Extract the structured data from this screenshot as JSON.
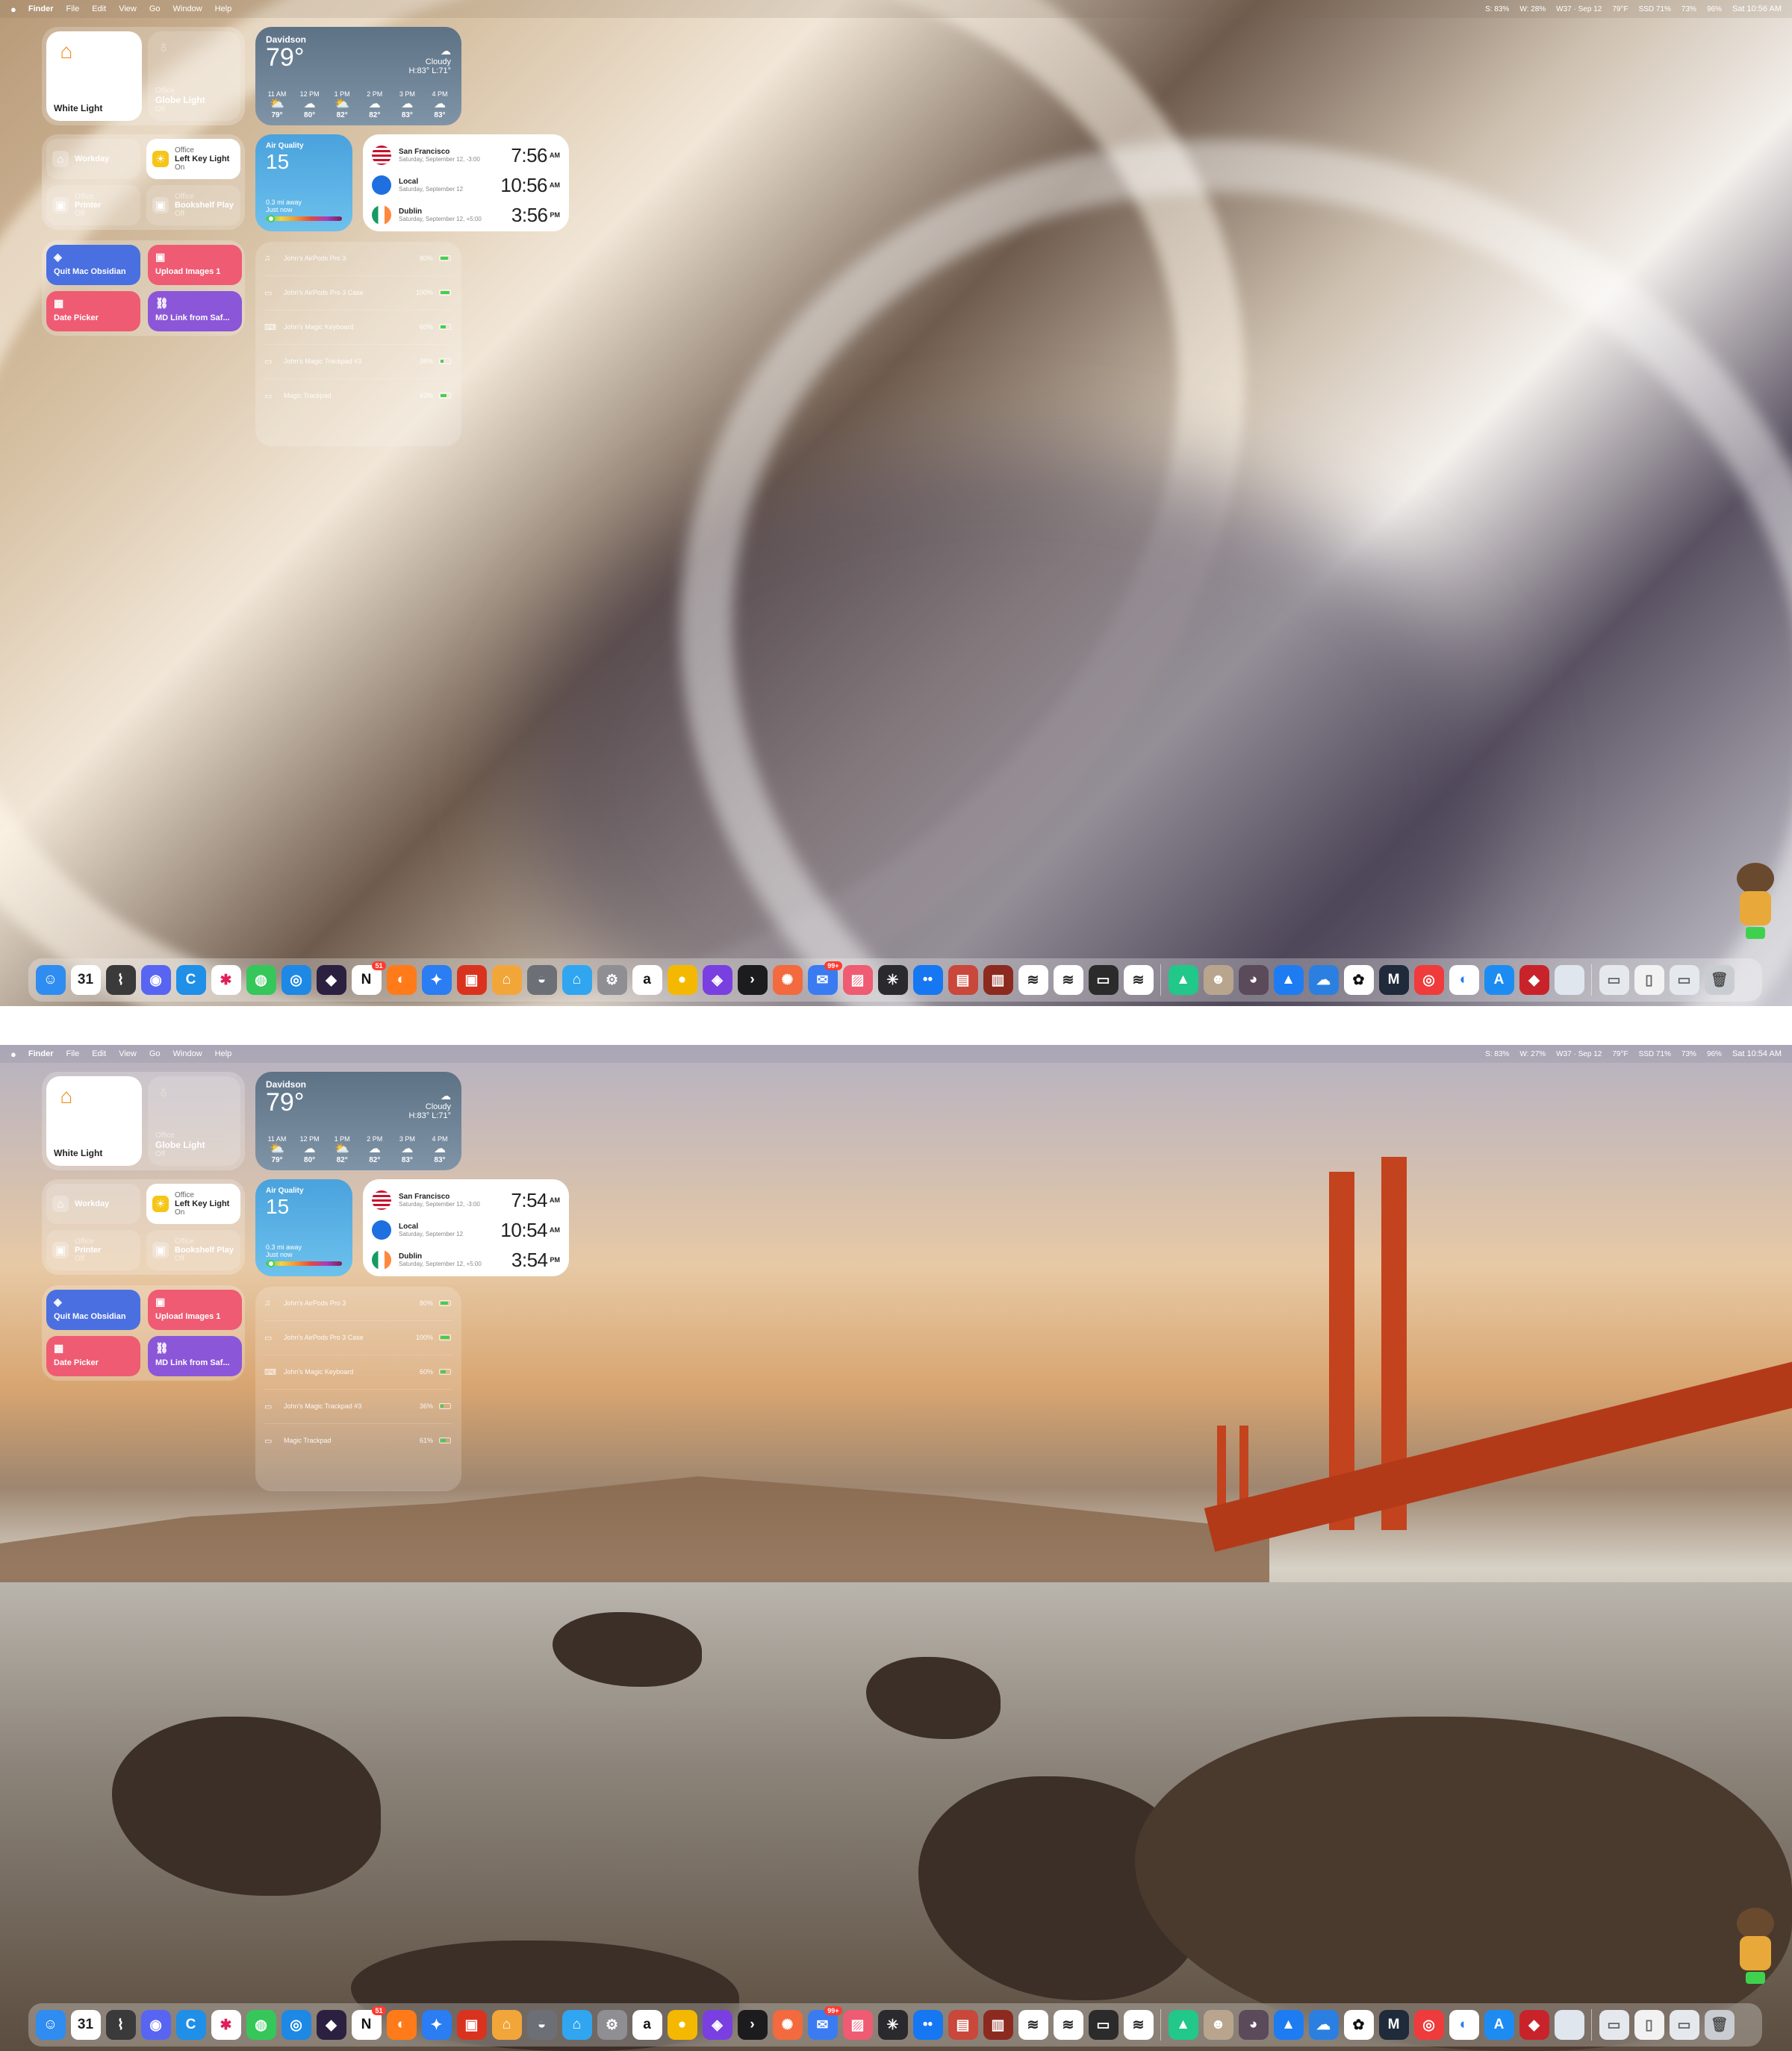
{
  "menubar": {
    "app": "Finder",
    "menus": [
      "File",
      "Edit",
      "View",
      "Go",
      "Window",
      "Help"
    ],
    "status": [
      "S: 83%",
      "79°F",
      "73%",
      "96%"
    ],
    "week": "W37 · Sep 12",
    "mem": "SSD 71%"
  },
  "screens": [
    {
      "w_status": "W: 28%",
      "clock": "Sat 10:56 AM"
    },
    {
      "w_status": "W: 27%",
      "clock": "Sat 10:54 AM"
    }
  ],
  "homekit": {
    "white_light": "White Light",
    "globe": {
      "room": "Office",
      "name": "Globe Light",
      "state": "Off"
    },
    "workday": "Workday",
    "left_key": {
      "room": "Office",
      "name": "Left Key Light",
      "state": "On"
    },
    "printer": {
      "room": "Office",
      "name": "Printer",
      "state": "Off"
    },
    "bookshelf": {
      "room": "Office",
      "name": "Bookshelf Play",
      "state": "Off"
    }
  },
  "weather": {
    "city": "Davidson",
    "temp": "79°",
    "condition": "Cloudy",
    "hilo": "H:83° L:71°",
    "hours": [
      {
        "time": "11 AM",
        "temp": "79°",
        "icon": "⛅"
      },
      {
        "time": "12 PM",
        "temp": "80°",
        "icon": "☁"
      },
      {
        "time": "1 PM",
        "temp": "82°",
        "icon": "⛅"
      },
      {
        "time": "2 PM",
        "temp": "82°",
        "icon": "☁"
      },
      {
        "time": "3 PM",
        "temp": "83°",
        "icon": "☁"
      },
      {
        "time": "4 PM",
        "temp": "83°",
        "icon": "☁"
      }
    ]
  },
  "air_quality": {
    "label": "Air Quality",
    "value": "15",
    "distance": "0.3 mi away",
    "updated": "Just now"
  },
  "world_clock": [
    {
      "city": "San Francisco",
      "date": "Saturday, September 12, -3:00",
      "times": [
        "7:56",
        "7:54"
      ],
      "ampm": "AM",
      "flag": "us"
    },
    {
      "city": "Local",
      "date": "Saturday, September 12",
      "times": [
        "10:56",
        "10:54"
      ],
      "ampm": "AM",
      "flag": "local"
    },
    {
      "city": "Dublin",
      "date": "Saturday, September 12, +5:00",
      "times": [
        "3:56",
        "3:54"
      ],
      "ampm": "PM",
      "flag": "ie"
    }
  ],
  "shortcuts": [
    {
      "label": "Quit Mac Obsidian",
      "color": "#4a6fe0",
      "icon": "layers-icon"
    },
    {
      "label": "Upload Images 1",
      "color": "#ef5b73",
      "icon": "photo-icon"
    },
    {
      "label": "Date Picker",
      "color": "#ef5b73",
      "icon": "calendar-icon"
    },
    {
      "label": "MD Link from Saf...",
      "color": "#8b56d8",
      "icon": "link-icon"
    }
  ],
  "batteries": {
    "screen1": [
      {
        "name": "John's AirPods Pro 3",
        "pct": "80%",
        "level": 0.8,
        "icon": "earbuds-icon"
      },
      {
        "name": "John's AirPods Pro 3 Case",
        "pct": "100%",
        "level": 1.0,
        "icon": "case-icon"
      },
      {
        "name": "John's Magic Keyboard",
        "pct": "60%",
        "level": 0.6,
        "icon": "keyboard-icon"
      },
      {
        "name": "John's Magic Trackpad #3",
        "pct": "36%",
        "level": 0.36,
        "icon": "trackpad-icon"
      },
      {
        "name": "Magic Trackpad",
        "pct": "63%",
        "level": 0.63,
        "icon": "trackpad-icon"
      }
    ],
    "screen2": [
      {
        "name": "John's AirPods Pro 3",
        "pct": "80%",
        "level": 0.8,
        "icon": "earbuds-icon"
      },
      {
        "name": "John's AirPods Pro 3 Case",
        "pct": "100%",
        "level": 1.0,
        "icon": "case-icon"
      },
      {
        "name": "John's Magic Keyboard",
        "pct": "60%",
        "level": 0.6,
        "icon": "keyboard-icon"
      },
      {
        "name": "John's Magic Trackpad #3",
        "pct": "36%",
        "level": 0.36,
        "icon": "trackpad-icon"
      },
      {
        "name": "Magic Trackpad",
        "pct": "61%",
        "level": 0.61,
        "icon": "trackpad-icon"
      }
    ]
  },
  "dock": {
    "apps": [
      {
        "name": "finder-icon",
        "color": "#2f8cf0",
        "glyph": "☺"
      },
      {
        "name": "calendar-icon",
        "color": "#ffffff",
        "glyph": "31",
        "text": "#222"
      },
      {
        "name": "rss-icon",
        "color": "#3a3a3a",
        "glyph": "⌇"
      },
      {
        "name": "discord-icon",
        "color": "#5865f2",
        "glyph": "◉"
      },
      {
        "name": "c-icon",
        "color": "#1f8fe8",
        "glyph": "C"
      },
      {
        "name": "slack-icon",
        "color": "#ffffff",
        "glyph": "✱",
        "text": "#e01e5a"
      },
      {
        "name": "messages-icon",
        "color": "#35c759",
        "glyph": "◍"
      },
      {
        "name": "safari-icon",
        "color": "#1e88e5",
        "glyph": "◎"
      },
      {
        "name": "obsidian-icon",
        "color": "#2b2040",
        "glyph": "◆"
      },
      {
        "name": "notion-icon",
        "color": "#ffffff",
        "glyph": "N",
        "text": "#111",
        "badge": "51"
      },
      {
        "name": "firefox-icon",
        "color": "#ff7b1a",
        "glyph": "◐"
      },
      {
        "name": "app-icon",
        "color": "#2a7df2",
        "glyph": "✦"
      },
      {
        "name": "photos-icon",
        "color": "#d9331f",
        "glyph": "▣"
      },
      {
        "name": "home-icon",
        "color": "#f2a63a",
        "glyph": "⌂"
      },
      {
        "name": "sphere-icon",
        "color": "#6c6f76",
        "glyph": "◒"
      },
      {
        "name": "home-app-icon",
        "color": "#30a6f0",
        "glyph": "⌂"
      },
      {
        "name": "settings-icon",
        "color": "#8e8e93",
        "glyph": "⚙"
      },
      {
        "name": "amazon-icon",
        "color": "#ffffff",
        "glyph": "a",
        "text": "#111"
      },
      {
        "name": "reeder-icon",
        "color": "#f5b800",
        "glyph": "●"
      },
      {
        "name": "shortcuts-icon",
        "color": "#7a3fe0",
        "glyph": "◈"
      },
      {
        "name": "prompt-icon",
        "color": "#1c1c1e",
        "glyph": "›"
      },
      {
        "name": "claude-icon",
        "color": "#f26a3d",
        "glyph": "✺"
      },
      {
        "name": "mail-icon",
        "color": "#3a7bf2",
        "glyph": "✉",
        "badge": "99+"
      },
      {
        "name": "image-icon",
        "color": "#ef5b73",
        "glyph": "▨"
      },
      {
        "name": "spider-icon",
        "color": "#2a2a2e",
        "glyph": "✳"
      },
      {
        "name": "dots-icon",
        "color": "#1577f2",
        "glyph": "••"
      },
      {
        "name": "cards-icon",
        "color": "#c9473b",
        "glyph": "▤"
      },
      {
        "name": "book-icon",
        "color": "#8c2a20",
        "glyph": "▥"
      },
      {
        "name": "stack-icon",
        "color": "#ffffff",
        "glyph": "≋",
        "text": "#222"
      },
      {
        "name": "stack-2-icon",
        "color": "#ffffff",
        "glyph": "≋",
        "text": "#222"
      },
      {
        "name": "terminal-icon",
        "color": "#2b2b2b",
        "glyph": "▭"
      },
      {
        "name": "stack-3-icon",
        "color": "#ffffff",
        "glyph": "≋",
        "text": "#222"
      }
    ],
    "apps2": [
      {
        "name": "triangle-icon",
        "color": "#22c78a",
        "glyph": "▲"
      },
      {
        "name": "robot-icon",
        "color": "#b9a58e",
        "glyph": "☻"
      },
      {
        "name": "record-icon",
        "color": "#5a4a5a",
        "glyph": "◕"
      },
      {
        "name": "arrow-icon",
        "color": "#1e7cf2",
        "glyph": "▲"
      },
      {
        "name": "cloud-icon",
        "color": "#2b7fe0",
        "glyph": "☁"
      },
      {
        "name": "chatgpt-icon",
        "color": "#ffffff",
        "glyph": "✿",
        "text": "#111"
      },
      {
        "name": "m-icon",
        "color": "#1f2a3a",
        "glyph": "M"
      },
      {
        "name": "lifebuoy-icon",
        "color": "#ef3b3b",
        "glyph": "◎"
      },
      {
        "name": "preview-icon",
        "color": "#ffffff",
        "glyph": "◐",
        "text": "#2a7df2"
      },
      {
        "name": "app-store-icon",
        "color": "#1d8cf2",
        "glyph": "A"
      },
      {
        "name": "box-icon",
        "color": "#c8232b",
        "glyph": "◆"
      },
      {
        "name": "blank-icon",
        "color": "#dfe6ee",
        "glyph": ""
      }
    ],
    "stacks": [
      {
        "name": "downloads-stack-icon",
        "color": "#e5e9ee",
        "glyph": "▭",
        "text": "#666"
      },
      {
        "name": "documents-stack-icon",
        "color": "#f2f2f2",
        "glyph": "▯",
        "text": "#666"
      },
      {
        "name": "screenshots-stack-icon",
        "color": "#e5e9ee",
        "glyph": "▭",
        "text": "#666"
      },
      {
        "name": "trash-icon",
        "color": "#c9cdd2",
        "glyph": "🗑",
        "text": "#555"
      }
    ]
  }
}
